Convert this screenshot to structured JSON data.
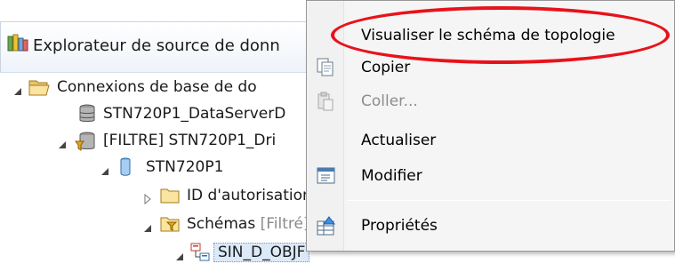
{
  "explorer": {
    "title": "Explorateur de source de donn",
    "tree": [
      {
        "label": "Connexions de base de do",
        "expanded": true
      },
      {
        "label": "STN720P1_DataServerD",
        "expanded": null
      },
      {
        "label": "[FILTRE] STN720P1_Dri",
        "expanded": true
      },
      {
        "label": "STN720P1",
        "expanded": true
      },
      {
        "label": "ID d'autorisation",
        "expanded": false
      },
      {
        "label": "Schémas",
        "filter_suffix": "[Filtré]",
        "expanded": true
      },
      {
        "label": "SIN_D_OBJF",
        "expanded": true
      }
    ]
  },
  "context_menu": {
    "items": [
      {
        "label": "Visualiser le schéma de topologie",
        "icon": "none",
        "enabled": true
      },
      {
        "label": "Copier",
        "icon": "copy-icon",
        "enabled": true
      },
      {
        "label": "Coller...",
        "icon": "paste-icon",
        "enabled": false
      },
      {
        "label": "Actualiser",
        "icon": "none",
        "enabled": true
      },
      {
        "label": "Modifier",
        "icon": "edit-icon",
        "enabled": true
      },
      {
        "label": "Propriétés",
        "icon": "properties-icon",
        "enabled": true
      }
    ]
  },
  "annotation": {
    "color": "#e8121a"
  }
}
